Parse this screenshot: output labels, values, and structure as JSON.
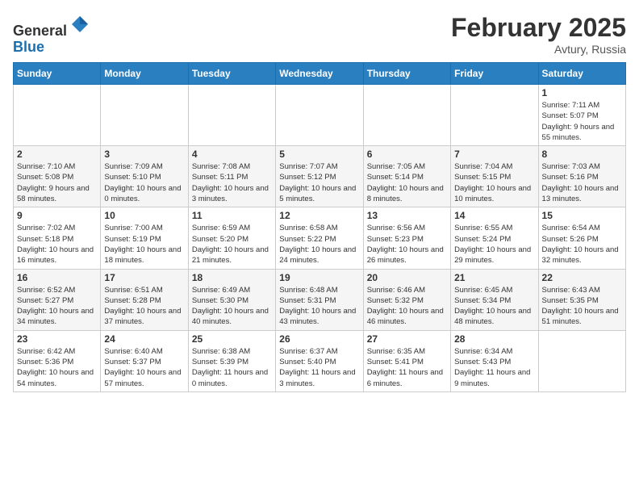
{
  "header": {
    "logo_line1": "General",
    "logo_line2": "Blue",
    "month_year": "February 2025",
    "location": "Avtury, Russia"
  },
  "days_of_week": [
    "Sunday",
    "Monday",
    "Tuesday",
    "Wednesday",
    "Thursday",
    "Friday",
    "Saturday"
  ],
  "weeks": [
    [
      {
        "day": "",
        "info": ""
      },
      {
        "day": "",
        "info": ""
      },
      {
        "day": "",
        "info": ""
      },
      {
        "day": "",
        "info": ""
      },
      {
        "day": "",
        "info": ""
      },
      {
        "day": "",
        "info": ""
      },
      {
        "day": "1",
        "info": "Sunrise: 7:11 AM\nSunset: 5:07 PM\nDaylight: 9 hours and 55 minutes."
      }
    ],
    [
      {
        "day": "2",
        "info": "Sunrise: 7:10 AM\nSunset: 5:08 PM\nDaylight: 9 hours and 58 minutes."
      },
      {
        "day": "3",
        "info": "Sunrise: 7:09 AM\nSunset: 5:10 PM\nDaylight: 10 hours and 0 minutes."
      },
      {
        "day": "4",
        "info": "Sunrise: 7:08 AM\nSunset: 5:11 PM\nDaylight: 10 hours and 3 minutes."
      },
      {
        "day": "5",
        "info": "Sunrise: 7:07 AM\nSunset: 5:12 PM\nDaylight: 10 hours and 5 minutes."
      },
      {
        "day": "6",
        "info": "Sunrise: 7:05 AM\nSunset: 5:14 PM\nDaylight: 10 hours and 8 minutes."
      },
      {
        "day": "7",
        "info": "Sunrise: 7:04 AM\nSunset: 5:15 PM\nDaylight: 10 hours and 10 minutes."
      },
      {
        "day": "8",
        "info": "Sunrise: 7:03 AM\nSunset: 5:16 PM\nDaylight: 10 hours and 13 minutes."
      }
    ],
    [
      {
        "day": "9",
        "info": "Sunrise: 7:02 AM\nSunset: 5:18 PM\nDaylight: 10 hours and 16 minutes."
      },
      {
        "day": "10",
        "info": "Sunrise: 7:00 AM\nSunset: 5:19 PM\nDaylight: 10 hours and 18 minutes."
      },
      {
        "day": "11",
        "info": "Sunrise: 6:59 AM\nSunset: 5:20 PM\nDaylight: 10 hours and 21 minutes."
      },
      {
        "day": "12",
        "info": "Sunrise: 6:58 AM\nSunset: 5:22 PM\nDaylight: 10 hours and 24 minutes."
      },
      {
        "day": "13",
        "info": "Sunrise: 6:56 AM\nSunset: 5:23 PM\nDaylight: 10 hours and 26 minutes."
      },
      {
        "day": "14",
        "info": "Sunrise: 6:55 AM\nSunset: 5:24 PM\nDaylight: 10 hours and 29 minutes."
      },
      {
        "day": "15",
        "info": "Sunrise: 6:54 AM\nSunset: 5:26 PM\nDaylight: 10 hours and 32 minutes."
      }
    ],
    [
      {
        "day": "16",
        "info": "Sunrise: 6:52 AM\nSunset: 5:27 PM\nDaylight: 10 hours and 34 minutes."
      },
      {
        "day": "17",
        "info": "Sunrise: 6:51 AM\nSunset: 5:28 PM\nDaylight: 10 hours and 37 minutes."
      },
      {
        "day": "18",
        "info": "Sunrise: 6:49 AM\nSunset: 5:30 PM\nDaylight: 10 hours and 40 minutes."
      },
      {
        "day": "19",
        "info": "Sunrise: 6:48 AM\nSunset: 5:31 PM\nDaylight: 10 hours and 43 minutes."
      },
      {
        "day": "20",
        "info": "Sunrise: 6:46 AM\nSunset: 5:32 PM\nDaylight: 10 hours and 46 minutes."
      },
      {
        "day": "21",
        "info": "Sunrise: 6:45 AM\nSunset: 5:34 PM\nDaylight: 10 hours and 48 minutes."
      },
      {
        "day": "22",
        "info": "Sunrise: 6:43 AM\nSunset: 5:35 PM\nDaylight: 10 hours and 51 minutes."
      }
    ],
    [
      {
        "day": "23",
        "info": "Sunrise: 6:42 AM\nSunset: 5:36 PM\nDaylight: 10 hours and 54 minutes."
      },
      {
        "day": "24",
        "info": "Sunrise: 6:40 AM\nSunset: 5:37 PM\nDaylight: 10 hours and 57 minutes."
      },
      {
        "day": "25",
        "info": "Sunrise: 6:38 AM\nSunset: 5:39 PM\nDaylight: 11 hours and 0 minutes."
      },
      {
        "day": "26",
        "info": "Sunrise: 6:37 AM\nSunset: 5:40 PM\nDaylight: 11 hours and 3 minutes."
      },
      {
        "day": "27",
        "info": "Sunrise: 6:35 AM\nSunset: 5:41 PM\nDaylight: 11 hours and 6 minutes."
      },
      {
        "day": "28",
        "info": "Sunrise: 6:34 AM\nSunset: 5:43 PM\nDaylight: 11 hours and 9 minutes."
      },
      {
        "day": "",
        "info": ""
      }
    ]
  ]
}
